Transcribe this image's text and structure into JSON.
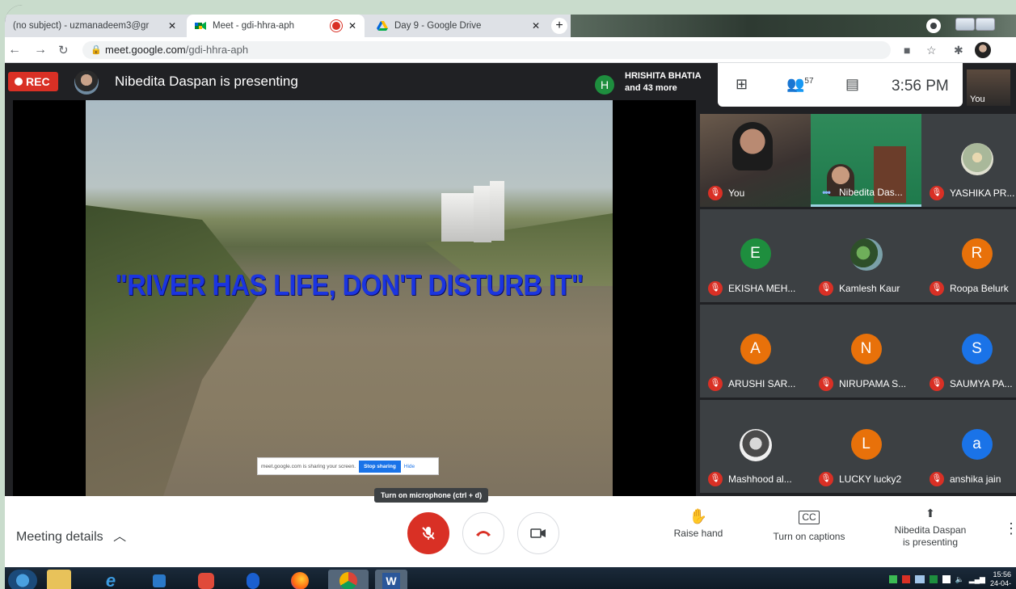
{
  "browser": {
    "tabs": [
      {
        "title": "(no subject) - uzmanadeem3@gr",
        "close": "✕",
        "active": false
      },
      {
        "title": "Meet - gdi-hhra-aph",
        "close": "✕",
        "active": true,
        "recording": true
      },
      {
        "title": "Day 9 - Google Drive",
        "close": "✕",
        "active": false
      }
    ],
    "new_tab": "+",
    "url_host": "meet.google.com",
    "url_path": "/gdi-hhra-aph"
  },
  "meet": {
    "rec_label": "REC",
    "presenting_text": "Nibedita Daspan is presenting",
    "raised_hand": {
      "initial": "H",
      "name": "HRISHITA BHATIA",
      "more": "and 43 more"
    },
    "participant_count": "57",
    "time": "3:56 PM",
    "self_label": "You",
    "slide_quote": "\"RIVER HAS LIFE, DON'T DISTURB IT\"",
    "share_bar": {
      "text": "meet.google.com is sharing your screen.",
      "stop": "Stop sharing",
      "hide": "Hide"
    },
    "tiles": [
      {
        "name": "You",
        "type": "video",
        "muted": true
      },
      {
        "name": "Nibedita Das...",
        "type": "video",
        "muted": false,
        "speaking": true
      },
      {
        "name": "YASHIKA PR...",
        "type": "photo",
        "muted": true
      },
      {
        "name": "EKISHA MEH...",
        "initial": "E",
        "color": "#1e8e3e",
        "muted": true
      },
      {
        "name": "Kamlesh Kaur",
        "type": "photo",
        "muted": true
      },
      {
        "name": "Roopa Belurk",
        "initial": "R",
        "color": "#e8710a",
        "muted": true
      },
      {
        "name": "ARUSHI SAR...",
        "initial": "A",
        "color": "#e8710a",
        "muted": true
      },
      {
        "name": "NIRUPAMA S...",
        "initial": "N",
        "color": "#e8710a",
        "muted": true
      },
      {
        "name": "SAUMYA PA...",
        "initial": "S",
        "color": "#1a73e8",
        "muted": true
      },
      {
        "name": "Mashhood al...",
        "type": "photo",
        "muted": true
      },
      {
        "name": "LUCKY lucky2",
        "initial": "L",
        "color": "#e8710a",
        "muted": true
      },
      {
        "name": "anshika jain",
        "initial": "a",
        "color": "#1a73e8",
        "muted": true
      }
    ],
    "controls": {
      "meeting_details": "Meeting details",
      "tooltip": "Turn on microphone (ctrl + d)",
      "raise_hand": "Raise hand",
      "captions": "Turn on captions",
      "presenting_line1": "Nibedita Daspan",
      "presenting_line2": "is presenting"
    }
  },
  "taskbar": {
    "time": "15:56",
    "date": "24-04-"
  },
  "colors": {
    "rec": "#d93025",
    "accent_green": "#1e8e3e",
    "accent_blue": "#1a73e8"
  }
}
